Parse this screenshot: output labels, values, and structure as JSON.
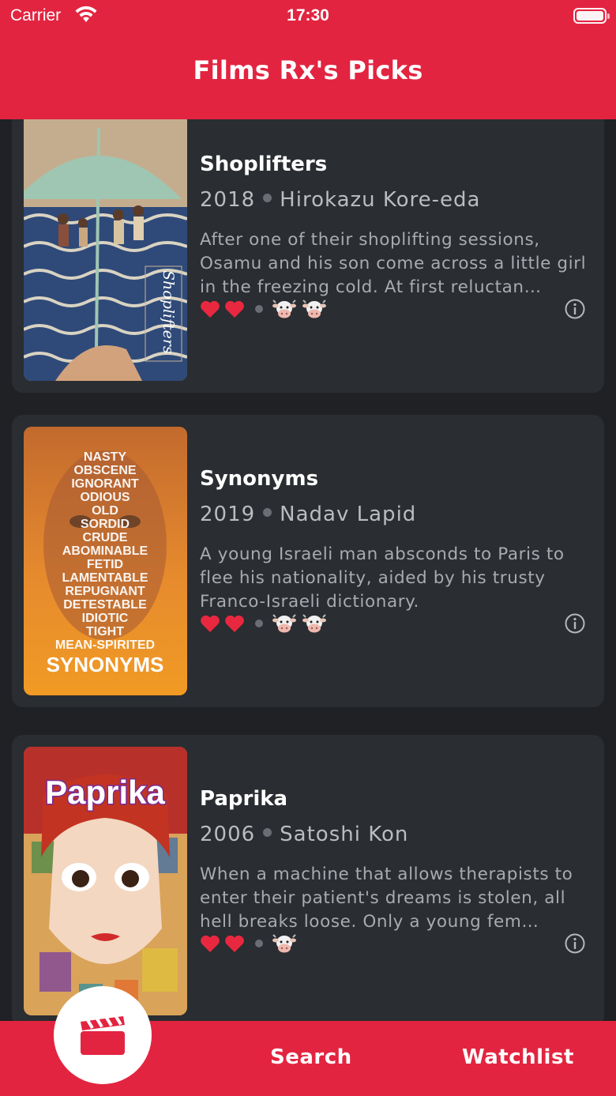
{
  "status_bar": {
    "carrier": "Carrier",
    "time": "17:30"
  },
  "header": {
    "title": "Films Rx's Picks"
  },
  "movies": [
    {
      "title": "Shoplifters",
      "year": "2018",
      "director": "Hirokazu Kore-eda",
      "synopsis": "After one of their shoplifting sessions, Osamu and his son come across a little girl in the freezing cold. At first reluctan…",
      "hearts": 2,
      "cows": 2,
      "poster_text": "Shoplifters"
    },
    {
      "title": "Synonyms",
      "year": "2019",
      "director": "Nadav Lapid",
      "synopsis": "A young Israeli man absconds to Paris to flee his nationality, aided by his trusty Franco-Israeli dictionary.",
      "hearts": 2,
      "cows": 2,
      "poster_words": [
        "NASTY",
        "OBSCENE",
        "IGNORANT",
        "ODIOUS",
        "OLD",
        "SORDID",
        "CRUDE",
        "ABOMINABLE",
        "FETID",
        "LAMENTABLE",
        "REPUGNANT",
        "DETESTABLE",
        "IDIOTIC",
        "TIGHT",
        "MEAN-SPIRITED"
      ],
      "poster_title": "SYNONYMS"
    },
    {
      "title": "Paprika",
      "year": "2006",
      "director": "Satoshi Kon",
      "synopsis": "When a machine that allows therapists to enter their patient's dreams is stolen, all hell breaks loose. Only a young fem…",
      "hearts": 2,
      "cows": 1,
      "poster_title": "Paprika"
    }
  ],
  "tabbar": {
    "search_label": "Search",
    "watchlist_label": "Watchlist"
  },
  "colors": {
    "accent": "#e32440",
    "background": "#1f2124",
    "card": "#2a2d31"
  }
}
